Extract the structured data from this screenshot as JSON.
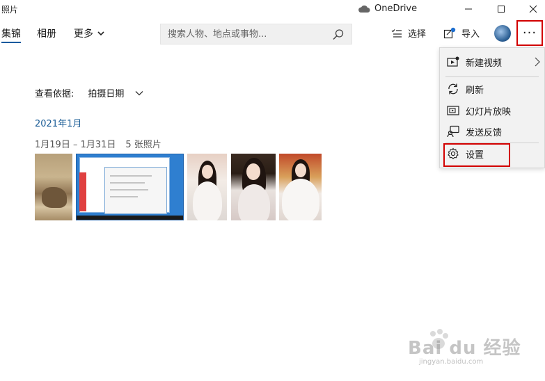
{
  "window": {
    "title": "照片",
    "onedrive_label": "OneDrive"
  },
  "nav": {
    "tabs": [
      {
        "label": "集锦",
        "active": true
      },
      {
        "label": "相册",
        "active": false
      },
      {
        "label": "更多",
        "active": false
      }
    ]
  },
  "search": {
    "placeholder": "搜索人物、地点或事物..."
  },
  "actions": {
    "select_label": "选择",
    "import_label": "导入",
    "more_label": "···"
  },
  "sort": {
    "label": "查看依据:",
    "value": "拍摄日期"
  },
  "group": {
    "month": "2021年1月",
    "date_range": "1月19日 – 1月31日",
    "count": "5 张照片"
  },
  "photos": [
    {
      "subject": "desert-rock-photo"
    },
    {
      "subject": "desktop-screenshot-photo"
    },
    {
      "subject": "portrait-photo-1"
    },
    {
      "subject": "portrait-photo-2"
    },
    {
      "subject": "portrait-photo-3"
    }
  ],
  "menu": {
    "items": [
      {
        "label": "新建视频",
        "icon": "video-icon",
        "has_submenu": true
      },
      {
        "label": "刷新",
        "icon": "refresh-icon"
      },
      {
        "label": "幻灯片放映",
        "icon": "slideshow-icon"
      },
      {
        "label": "发送反馈",
        "icon": "feedback-icon"
      },
      {
        "label": "设置",
        "icon": "gear-icon"
      }
    ]
  },
  "watermark": {
    "text": "Bai du 经验",
    "url": "jingyan.baidu.com"
  },
  "colors": {
    "accent": "#005a9e",
    "month_heading": "#1a5c96",
    "highlight_box": "#d20000",
    "menu_bg": "#f2f2f2"
  }
}
